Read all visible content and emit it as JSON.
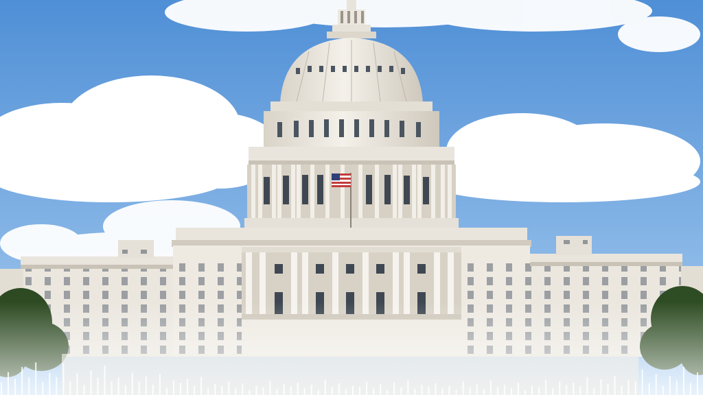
{
  "image": {
    "subject": "capitol-building",
    "colors": {
      "sky_top": "#4f8fd6",
      "sky_bottom": "#a9cdf0",
      "cloud": "#ffffff",
      "building": "#eeeae2",
      "building_shadow": "#cfc8bc",
      "trees": "#2d4a22",
      "waveform": "#ffffff"
    },
    "overlay": {
      "type": "audio-waveform",
      "bars": [
        0.3,
        0.55,
        0.4,
        0.7,
        0.45,
        0.85,
        0.35,
        0.6,
        0.5,
        0.9,
        0.4,
        0.65,
        0.3,
        0.75,
        0.55,
        0.95,
        0.45,
        0.6,
        0.35,
        0.8,
        0.5,
        0.7,
        0.4,
        0.85,
        0.3,
        0.65,
        0.55,
        0.75,
        0.45,
        0.9,
        0.35,
        0.6,
        0.5,
        0.8,
        0.4,
        0.7,
        0.3,
        0.55,
        0.45,
        0.85,
        0.35,
        0.65,
        0.5,
        0.75,
        0.4,
        0.6,
        0.3,
        0.9,
        0.45,
        0.7,
        0.35,
        0.55,
        0.5,
        0.8,
        0.4,
        0.65,
        0.3,
        0.75,
        0.45,
        0.85,
        0.35,
        0.6,
        0.5,
        0.7,
        0.4,
        0.55,
        0.3,
        0.8,
        0.45,
        0.65,
        0.35,
        0.9,
        0.5,
        0.6,
        0.4,
        0.75,
        0.3,
        0.55,
        0.45,
        0.85,
        0.35,
        0.7,
        0.5,
        0.6,
        0.4,
        0.8,
        0.3,
        0.65,
        0.45,
        0.75,
        0.35,
        0.55,
        0.5,
        0.9,
        0.4,
        0.7,
        0.3,
        0.6,
        0.45,
        0.85,
        0.35,
        0.65
      ]
    }
  }
}
